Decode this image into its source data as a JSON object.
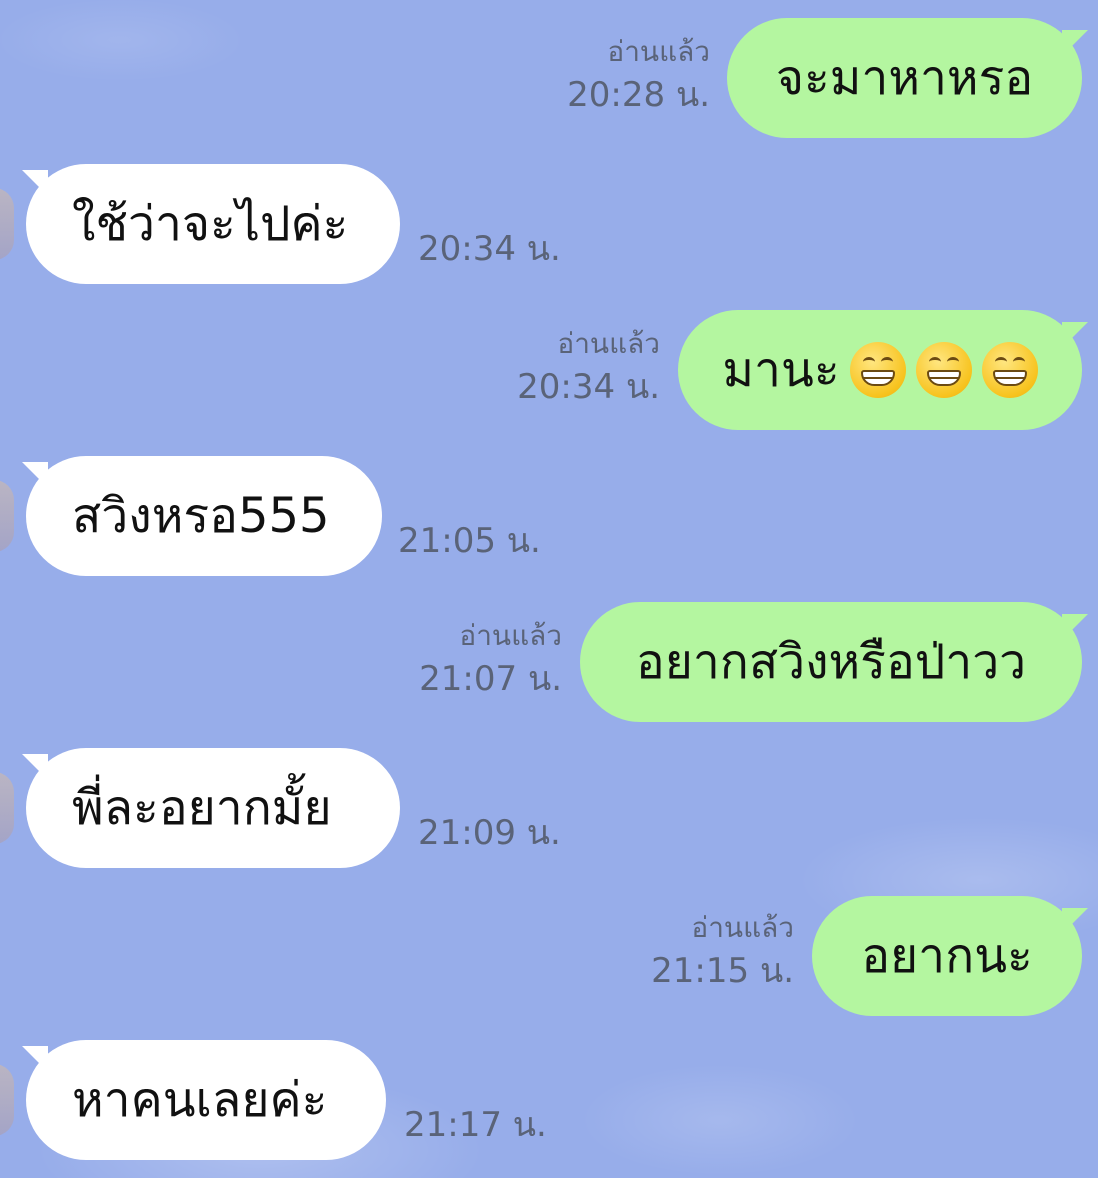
{
  "chat": {
    "messages": [
      {
        "direction": "out",
        "text": "จะมาหาหรอ",
        "read_label": "อ่านแล้ว",
        "time": "20:28 น."
      },
      {
        "direction": "in",
        "text": "ใช้ว่าจะไปค่ะ",
        "time": "20:34 น."
      },
      {
        "direction": "out",
        "text": "มานะ",
        "emoji": [
          "grinning-face-icon",
          "grinning-face-icon",
          "grinning-face-icon"
        ],
        "read_label": "อ่านแล้ว",
        "time": "20:34 น."
      },
      {
        "direction": "in",
        "text": "สวิงหรอ555",
        "time": "21:05 น."
      },
      {
        "direction": "out",
        "text": "อยากสวิงหรือป่าวว",
        "read_label": "อ่านแล้ว",
        "time": "21:07 น."
      },
      {
        "direction": "in",
        "text": "พี่ละอยากมั้ย",
        "time": "21:09 น."
      },
      {
        "direction": "out",
        "text": "อยากนะ",
        "read_label": "อ่านแล้ว",
        "time": "21:15 น."
      },
      {
        "direction": "in",
        "text": "หาคนเลยค่ะ",
        "time": "21:17 น."
      }
    ]
  },
  "colors": {
    "background": "#97ADEA",
    "outgoing_bubble": "#B4F6A0",
    "incoming_bubble": "#FFFFFF",
    "meta_text": "#5A6378"
  }
}
